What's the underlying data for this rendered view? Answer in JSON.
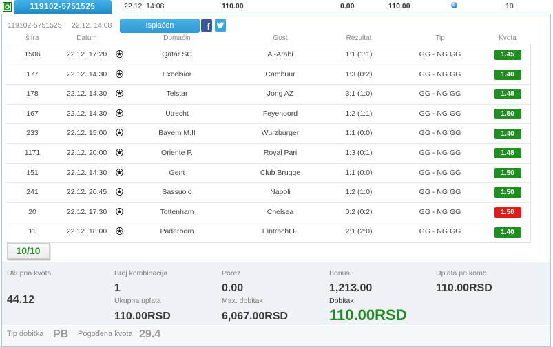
{
  "top_bar": {
    "status_letter": "O",
    "ticket_id": "119102-5751525",
    "datetime": "22.12. 14:08",
    "stake": "110.00",
    "tax": "0.00",
    "payout": "110.00",
    "status_icon": "globe-icon",
    "event_count": "10"
  },
  "ticket_header": {
    "ticket_id": "119102-5751525",
    "datetime": "22.12. 14:08",
    "status_label": "Isplaćen",
    "facebook_glyph": "f",
    "share_icons": [
      "facebook-icon",
      "twitter-icon"
    ]
  },
  "table": {
    "headers": {
      "code": "šifra",
      "date": "Datum",
      "home": "Domaćin",
      "away": "Gost",
      "result": "Rezultat",
      "tip": "Tip",
      "odds": "Kvota"
    },
    "sport_icon": "soccer-ball-icon",
    "rows": [
      {
        "code": "1506",
        "date": "22.12. 17:20",
        "home": "Qatar SC",
        "away": "Al-Arabi",
        "result": "1:1 (1:1)",
        "tip": "GG - NG GG",
        "odds": "1.45",
        "odds_color": "#1f8f1f"
      },
      {
        "code": "177",
        "date": "22.12. 14:30",
        "home": "Excelsior",
        "away": "Cambuur",
        "result": "1:3 (0:2)",
        "tip": "GG - NG GG",
        "odds": "1.40",
        "odds_color": "#1f8f1f"
      },
      {
        "code": "178",
        "date": "22.12. 14:30",
        "home": "Telstar",
        "away": "Jong AZ",
        "result": "3:1 (1:0)",
        "tip": "GG - NG GG",
        "odds": "1.48",
        "odds_color": "#1f8f1f"
      },
      {
        "code": "167",
        "date": "22.12. 14:30",
        "home": "Utrecht",
        "away": "Feyenoord",
        "result": "1:2 (1:1)",
        "tip": "GG - NG GG",
        "odds": "1.50",
        "odds_color": "#1f8f1f"
      },
      {
        "code": "233",
        "date": "22.12. 15:00",
        "home": "Bayern M.II",
        "away": "Wurzburger",
        "result": "1:1 (0:0)",
        "tip": "GG - NG GG",
        "odds": "1.40",
        "odds_color": "#1f8f1f"
      },
      {
        "code": "1171",
        "date": "22.12. 20:00",
        "home": "Oriente P.",
        "away": "Royal Pari",
        "result": "1:3 (0:1)",
        "tip": "GG - NG GG",
        "odds": "1.48",
        "odds_color": "#1f8f1f"
      },
      {
        "code": "151",
        "date": "22.12. 14:30",
        "home": "Gent",
        "away": "Club Brugge",
        "result": "1:1 (0:0)",
        "tip": "GG - NG GG",
        "odds": "1.50",
        "odds_color": "#1f8f1f"
      },
      {
        "code": "241",
        "date": "22.12. 20:45",
        "home": "Sassuolo",
        "away": "Napoli",
        "result": "1:2 (1:0)",
        "tip": "GG - NG GG",
        "odds": "1.50",
        "odds_color": "#1f8f1f"
      },
      {
        "code": "20",
        "date": "22.12. 17:30",
        "home": "Tottenham",
        "away": "Chelsea",
        "result": "0:2 (0:2)",
        "tip": "GG - NG GG",
        "odds": "1.50",
        "odds_color": "#e51c16"
      },
      {
        "code": "11",
        "date": "22.12. 18:00",
        "home": "Paderborn",
        "away": "Eintracht F.",
        "result": "2:1 (2:0)",
        "tip": "GG - NG GG",
        "odds": "1.40",
        "odds_color": "#1f8f1f"
      }
    ]
  },
  "hits": "10/10",
  "summary": {
    "total_odds_label": "Ukupna kvota",
    "total_odds": "44.12",
    "combinations_label": "Broj kombinacija",
    "combinations": "1",
    "total_stake_label": "Ukupna uplata",
    "total_stake": "110.00RSD",
    "tax_label": "Porez",
    "tax": "0.00",
    "max_win_label": "Max. dobitak",
    "max_win": "6,067.00RSD",
    "bonus_label": "Bonus",
    "bonus": "1,213.00",
    "win_label": "Dobitak",
    "win": "110.00RSD",
    "stake_per_comb_label": "Uplata po komb.",
    "stake_per_comb": "110.00RSD"
  },
  "footer": {
    "win_type_label": "Tip dobitka",
    "win_type": "PB",
    "hit_odds_label": "Pogođena kvota",
    "hit_odds": "29.4"
  },
  "colors": {
    "accent": "#2c9fd9",
    "status": "#2b9a2b",
    "win": "#1d8b1d",
    "odds_green": "#1f8f1f",
    "odds_red": "#e51c16"
  }
}
